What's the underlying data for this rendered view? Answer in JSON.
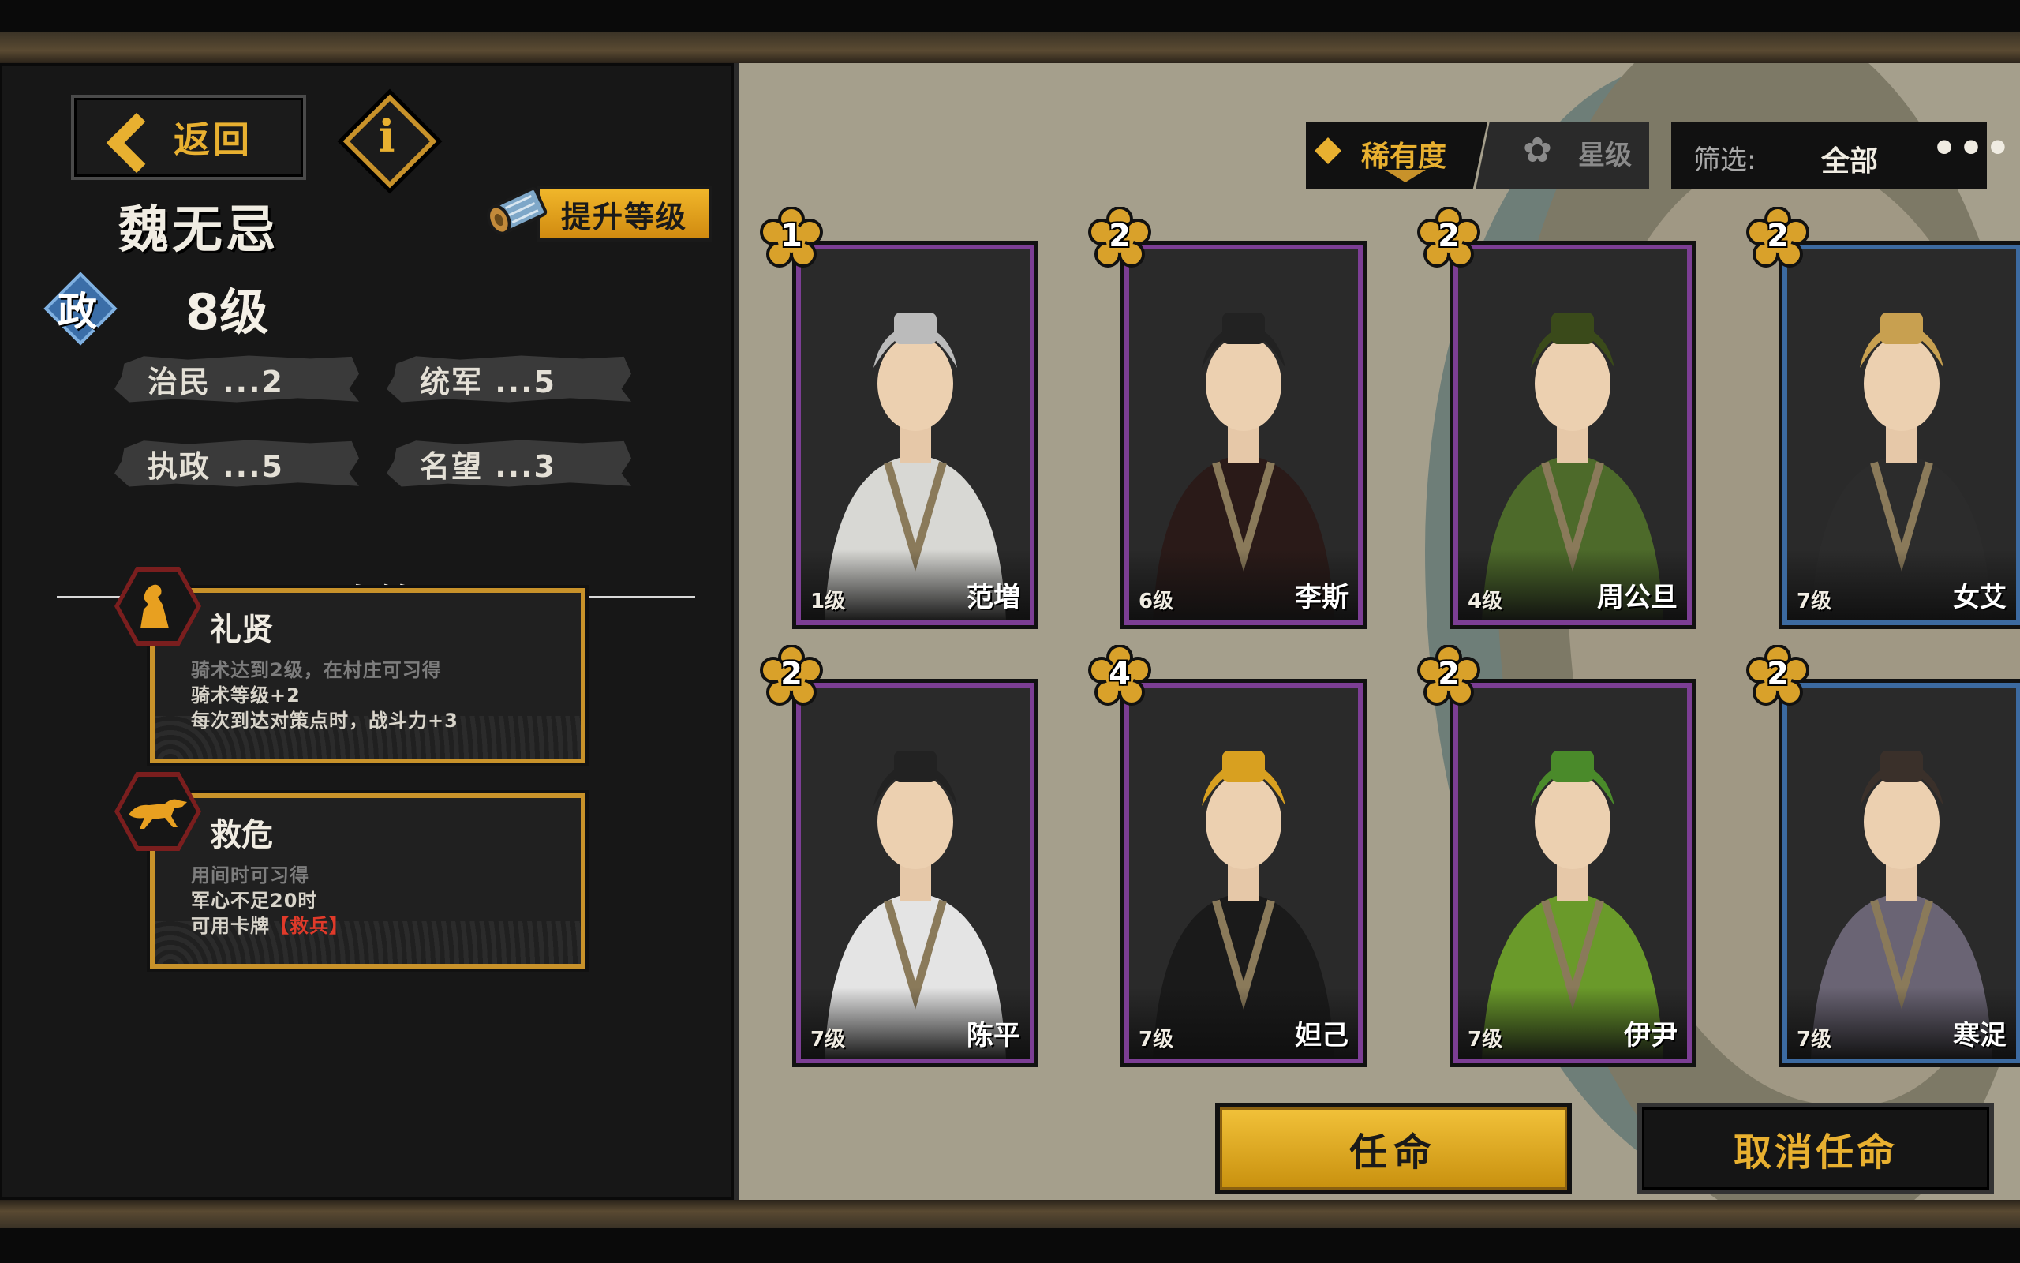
{
  "back_label": "返回",
  "info_label": "i",
  "hero": {
    "name": "魏无忌",
    "type_badge": "政",
    "level": "8级",
    "upgrade_label": "提升等级",
    "stats": [
      {
        "label": "治民 ...2"
      },
      {
        "label": "统军 ...5"
      },
      {
        "label": "执政 ...5"
      },
      {
        "label": "名望 ...3"
      }
    ]
  },
  "policy": {
    "title": "政策",
    "items": [
      {
        "name": "礼贤",
        "lines": [
          {
            "text": "骑术达到2级，在村庄可习得",
            "color": "#7d7d7d"
          },
          {
            "text": "骑术等级+2",
            "color": "#d8d4ca"
          },
          {
            "text": "每次到达对策点时，战斗力+3",
            "color": "#d8d4ca"
          }
        ]
      },
      {
        "name": "救危",
        "lines": [
          {
            "text": "用间时可习得",
            "color": "#7d7d7d"
          },
          {
            "text": "军心不足20时",
            "color": "#d8d4ca"
          },
          {
            "text": "可用卡牌",
            "color": "#d8d4ca"
          }
        ],
        "highlight": "【救兵】"
      }
    ]
  },
  "sort": {
    "rarity_label": "稀有度",
    "star_label": "星级"
  },
  "filter": {
    "label": "筛选:",
    "value": "全部",
    "more": "•••"
  },
  "cards": [
    {
      "rank": "1",
      "level": "1级",
      "name": "范増",
      "frame": "purple"
    },
    {
      "rank": "2",
      "level": "6级",
      "name": "李斯",
      "frame": "purple"
    },
    {
      "rank": "2",
      "level": "4级",
      "name": "周公旦",
      "frame": "purple"
    },
    {
      "rank": "2",
      "level": "7级",
      "name": "女艾",
      "frame": "blue"
    },
    {
      "rank": "2",
      "level": "7级",
      "name": "陈平",
      "frame": "purple"
    },
    {
      "rank": "4",
      "level": "7级",
      "name": "妲己",
      "frame": "purple"
    },
    {
      "rank": "2",
      "level": "7级",
      "name": "伊尹",
      "frame": "purple"
    },
    {
      "rank": "2",
      "level": "7级",
      "name": "寒浞",
      "frame": "blue"
    }
  ],
  "actions": {
    "appoint_label": "任命",
    "dismiss_label": "取消任命"
  },
  "colors": {
    "gold": "#e8b030",
    "purple_frame": "#7c3e94",
    "blue_frame": "#3c6aa0",
    "map_bg": "#a59f8c"
  }
}
